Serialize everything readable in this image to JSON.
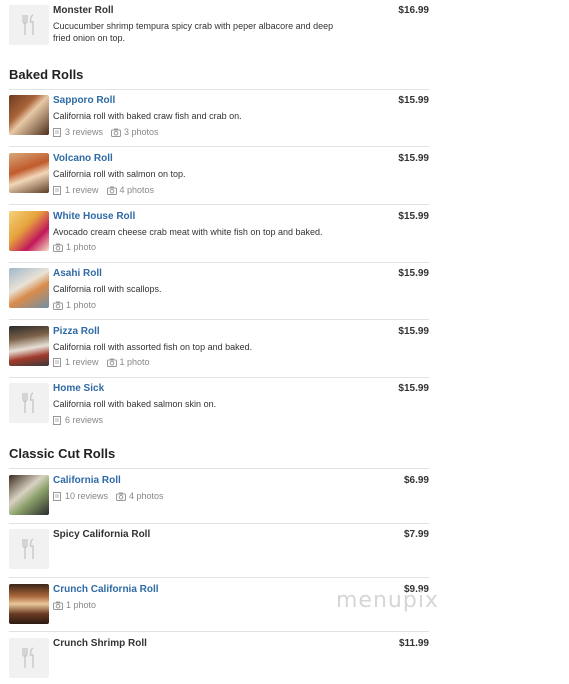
{
  "top_item": {
    "name": "Monster Roll",
    "price": "$16.99",
    "description": "Cucucumber shrimp tempura spicy crab with peper albacore and deep fried onion on top.",
    "image": "placeholder-fork-knife-icon"
  },
  "sections": [
    {
      "title": "Baked Rolls",
      "items": [
        {
          "name": "Sapporo Roll",
          "price": "$15.99",
          "description": "California roll with baked craw fish and crab on.",
          "reviews": "3 reviews",
          "photos": "3 photos"
        },
        {
          "name": "Volcano Roll",
          "price": "$15.99",
          "description": "California roll with salmon on top.",
          "reviews": "1 review",
          "photos": "4 photos"
        },
        {
          "name": "White House Roll",
          "price": "$15.99",
          "description": "Avocado cream cheese crab meat with white fish on top and baked.",
          "photos": "1 photo"
        },
        {
          "name": "Asahi Roll",
          "price": "$15.99",
          "description": "California roll with scallops.",
          "photos": "1 photo"
        },
        {
          "name": "Pizza Roll",
          "price": "$15.99",
          "description": "California roll with assorted fish on top and baked.",
          "reviews": "1 review",
          "photos": "1 photo"
        },
        {
          "name": "Home Sick",
          "price": "$15.99",
          "description": "California roll with baked salmon skin on.",
          "reviews": "6 reviews"
        }
      ]
    },
    {
      "title": "Classic Cut Rolls",
      "items": [
        {
          "name": "California Roll",
          "price": "$6.99",
          "reviews": "10 reviews",
          "photos": "4 photos"
        },
        {
          "name": "Spicy California Roll",
          "price": "$7.99"
        },
        {
          "name": "Crunch California Roll",
          "price": "$9.99",
          "photos": "1 photo"
        },
        {
          "name": "Crunch Shrimp Roll",
          "price": "$11.99"
        }
      ]
    }
  ],
  "watermark": "menupix",
  "colors": {
    "link": "#2e6aa5",
    "text": "#333333",
    "meta": "#888888",
    "divider": "#e2e2e2"
  }
}
